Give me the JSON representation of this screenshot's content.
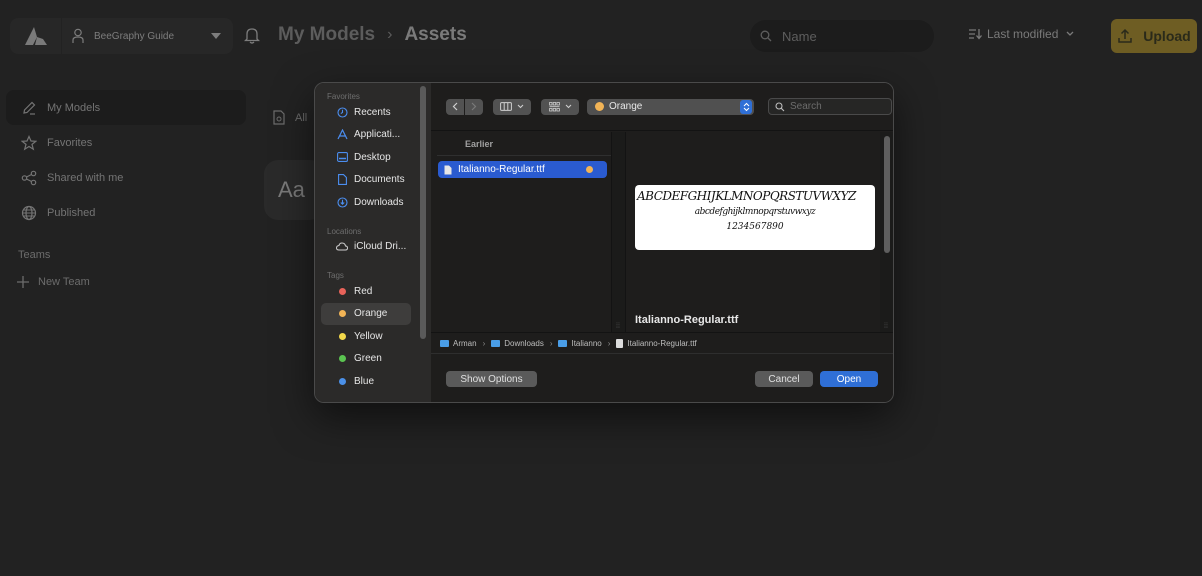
{
  "app": {
    "account_name": "BeeGraphy Guide",
    "breadcrumb": [
      "My Models",
      "Assets"
    ],
    "search_placeholder": "Name",
    "sort_label": "Last modified",
    "upload_label": "Upload",
    "accent_color": "#6e5d23"
  },
  "sidebar": {
    "items": [
      {
        "label": "My Models",
        "icon": "pencil-icon",
        "active": true
      },
      {
        "label": "Favorites",
        "icon": "star-icon"
      },
      {
        "label": "Shared with me",
        "icon": "share-icon"
      },
      {
        "label": "Published",
        "icon": "globe-icon"
      }
    ],
    "teams_heading": "Teams",
    "new_team_label": "New Team"
  },
  "content": {
    "all_assets_label": "All",
    "asset_card_glyph": "Aa"
  },
  "dialog": {
    "favorites_heading": "Favorites",
    "favorites": [
      {
        "label": "Recents",
        "icon": "clock-icon"
      },
      {
        "label": "Applicati...",
        "icon": "applications-icon"
      },
      {
        "label": "Desktop",
        "icon": "desktop-icon"
      },
      {
        "label": "Documents",
        "icon": "document-icon"
      },
      {
        "label": "Downloads",
        "icon": "download-icon"
      }
    ],
    "locations_heading": "Locations",
    "locations": [
      {
        "label": "iCloud Dri...",
        "icon": "cloud-icon"
      }
    ],
    "tags_heading": "Tags",
    "tags": [
      {
        "label": "Red",
        "color": "#e8635a"
      },
      {
        "label": "Orange",
        "color": "#f2b456",
        "selected": true
      },
      {
        "label": "Yellow",
        "color": "#f3d94b"
      },
      {
        "label": "Green",
        "color": "#5bc451"
      },
      {
        "label": "Blue",
        "color": "#4b90e8"
      }
    ],
    "location_value": "Orange",
    "location_color": "#f2b456",
    "search_placeholder": "Search",
    "column_heading": "Earlier",
    "files": [
      {
        "name": "Italianno-Regular.ttf",
        "tag_color": "#f2b456",
        "selected": true
      }
    ],
    "preview": {
      "uppercase": "ABCDEFGHIJKLMNOPQRSTUVWXYZ",
      "lowercase": "abcdefghijklmnopqrstuvwxyz",
      "digits": "1234567890",
      "file_name": "Italianno-Regular.ttf"
    },
    "path": [
      "Arman",
      "Downloads",
      "Italianno",
      "Italianno-Regular.ttf"
    ],
    "show_options_label": "Show Options",
    "cancel_label": "Cancel",
    "open_label": "Open"
  }
}
